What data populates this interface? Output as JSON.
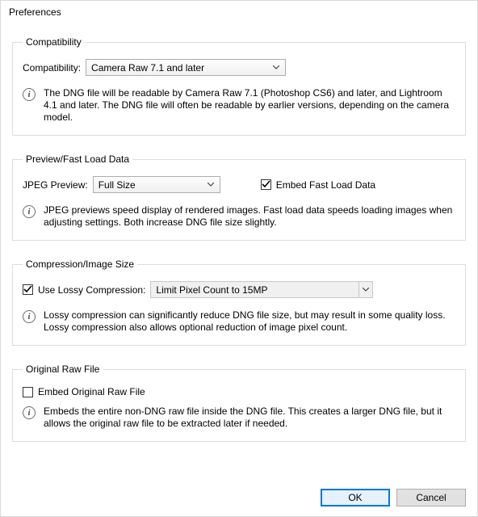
{
  "window": {
    "title": "Preferences"
  },
  "compat": {
    "legend": "Compatibility",
    "label": "Compatibility:",
    "value": "Camera Raw 7.1 and later",
    "info": "The DNG file will be readable by Camera Raw 7.1 (Photoshop CS6) and later, and Lightroom 4.1 and later. The DNG file will often be readable by earlier versions, depending on the camera model."
  },
  "preview": {
    "legend": "Preview/Fast Load Data",
    "label": "JPEG Preview:",
    "value": "Full Size",
    "embed_label": "Embed Fast Load Data",
    "info": "JPEG previews speed display of rendered images.  Fast load data speeds loading images when adjusting settings.  Both increase DNG file size slightly."
  },
  "compress": {
    "legend": "Compression/Image Size",
    "use_label": "Use Lossy Compression:",
    "value": "Limit Pixel Count to 15MP",
    "info": "Lossy compression can significantly reduce DNG file size, but may result in some quality loss.  Lossy compression also allows optional reduction of image pixel count."
  },
  "original": {
    "legend": "Original Raw File",
    "embed_label": "Embed Original Raw File",
    "info": "Embeds the entire non-DNG raw file inside the DNG file.  This creates a larger DNG file, but it allows the original raw file to be extracted later if needed."
  },
  "buttons": {
    "ok": "OK",
    "cancel": "Cancel"
  }
}
